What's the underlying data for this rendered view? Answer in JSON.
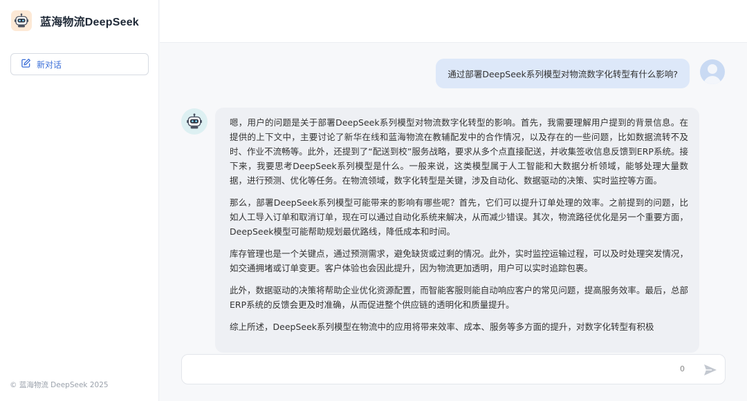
{
  "brand": {
    "title": "蓝海物流DeepSeek",
    "logo_icon": "robot-icon"
  },
  "sidebar": {
    "new_chat_label": "新对话",
    "new_chat_icon": "edit-icon",
    "footer_text": "© 蓝海物流 DeepSeek 2025"
  },
  "conversation": {
    "user_message": "通过部署DeepSeek系列模型对物流数字化转型有什么影响?",
    "bot_paragraphs": [
      "嗯，用户的问题是关于部署DeepSeek系列模型对物流数字化转型的影响。首先，我需要理解用户提到的背景信息。在提供的上下文中，主要讨论了新华在线和蓝海物流在教辅配发中的合作情况，以及存在的一些问题，比如数据流转不及时、作业不流畅等。此外，还提到了“配送到校”服务战略，要求从多个点直接配送，并收集签收信息反馈到ERP系统。接下来，我要思考DeepSeek系列模型是什么。一般来说，这类模型属于人工智能和大数据分析领域，能够处理大量数据，进行预测、优化等任务。在物流领域，数字化转型是关键，涉及自动化、数据驱动的决策、实时监控等方面。",
      "那么，部署DeepSeek系列模型可能带来的影响有哪些呢？首先，它们可以提升订单处理的效率。之前提到的问题，比如人工导入订单和取消订单，现在可以通过自动化系统来解决，从而减少错误。其次，物流路径优化是另一个重要方面，DeepSeek模型可能帮助规划最优路线，降低成本和时间。",
      "库存管理也是一个关键点，通过预测需求，避免缺货或过剩的情况。此外，实时监控运输过程，可以及时处理突发情况，如交通拥堵或订单变更。客户体验也会因此提升，因为物流更加透明，用户可以实时追踪包裹。",
      "此外，数据驱动的决策将帮助企业优化资源配置，而智能客服则能自动响应客户的常见问题，提高服务效率。最后，总部ERP系统的反馈会更及时准确，从而促进整个供应链的透明化和质量提升。",
      "综上所述，DeepSeek系列模型在物流中的应用将带来效率、成本、服务等多方面的提升，对数字化转型有积极"
    ]
  },
  "composer": {
    "placeholder": "",
    "char_count": "0",
    "send_icon": "send-icon"
  },
  "colors": {
    "accent": "#3b6fd8",
    "user_bubble": "#dde8f9",
    "bot_bubble": "#eef0f4"
  }
}
